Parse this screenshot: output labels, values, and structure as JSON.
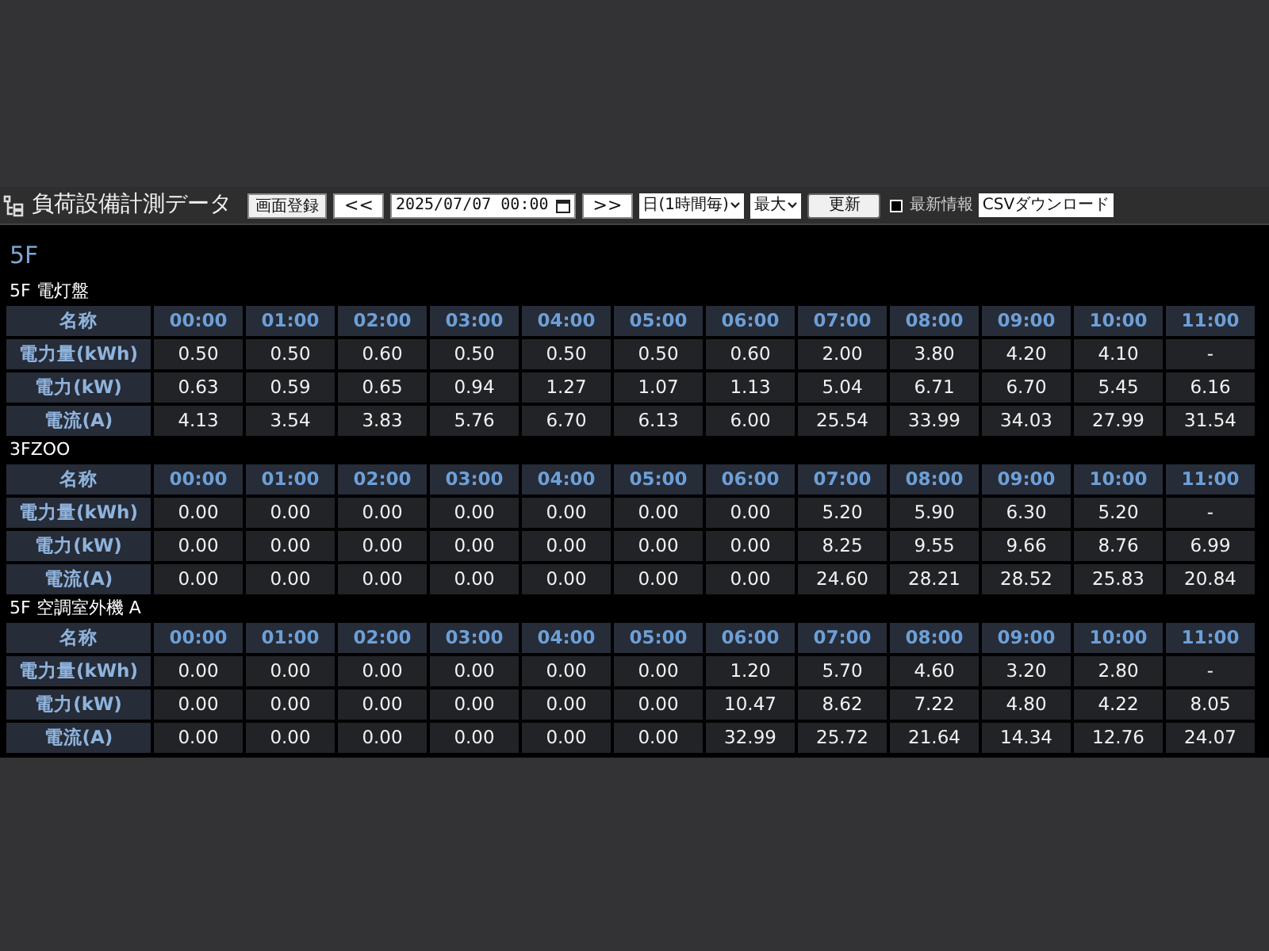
{
  "app": {
    "title": "負荷設備計測データ"
  },
  "toolbar": {
    "register_button": "画面登録",
    "prev_button": "<<",
    "date": "2025/07/07 00:00",
    "next_button": ">>",
    "period_select": "日(1時間毎)",
    "mode_select": "最大",
    "update_button": "更新",
    "latest_info": {
      "label": "最新情報",
      "checked": false
    },
    "csv_button": "CSVダウンロード"
  },
  "floor": "5F",
  "sections": [
    {
      "title": "5F 電灯盤",
      "header": "名称",
      "times": [
        "00:00",
        "01:00",
        "02:00",
        "03:00",
        "04:00",
        "05:00",
        "06:00",
        "07:00",
        "08:00",
        "09:00",
        "10:00",
        "11:00"
      ],
      "rows": [
        {
          "label": "電力量(kWh)",
          "values": [
            "0.50",
            "0.50",
            "0.60",
            "0.50",
            "0.50",
            "0.50",
            "0.60",
            "2.00",
            "3.80",
            "4.20",
            "4.10",
            "-"
          ]
        },
        {
          "label": "電力(kW)",
          "values": [
            "0.63",
            "0.59",
            "0.65",
            "0.94",
            "1.27",
            "1.07",
            "1.13",
            "5.04",
            "6.71",
            "6.70",
            "5.45",
            "6.16"
          ]
        },
        {
          "label": "電流(A)",
          "values": [
            "4.13",
            "3.54",
            "3.83",
            "5.76",
            "6.70",
            "6.13",
            "6.00",
            "25.54",
            "33.99",
            "34.03",
            "27.99",
            "31.54"
          ]
        }
      ]
    },
    {
      "title": "3FZOO",
      "header": "名称",
      "times": [
        "00:00",
        "01:00",
        "02:00",
        "03:00",
        "04:00",
        "05:00",
        "06:00",
        "07:00",
        "08:00",
        "09:00",
        "10:00",
        "11:00"
      ],
      "rows": [
        {
          "label": "電力量(kWh)",
          "values": [
            "0.00",
            "0.00",
            "0.00",
            "0.00",
            "0.00",
            "0.00",
            "0.00",
            "5.20",
            "5.90",
            "6.30",
            "5.20",
            "-"
          ]
        },
        {
          "label": "電力(kW)",
          "values": [
            "0.00",
            "0.00",
            "0.00",
            "0.00",
            "0.00",
            "0.00",
            "0.00",
            "8.25",
            "9.55",
            "9.66",
            "8.76",
            "6.99"
          ]
        },
        {
          "label": "電流(A)",
          "values": [
            "0.00",
            "0.00",
            "0.00",
            "0.00",
            "0.00",
            "0.00",
            "0.00",
            "24.60",
            "28.21",
            "28.52",
            "25.83",
            "20.84"
          ]
        }
      ]
    },
    {
      "title": "5F 空調室外機 A",
      "header": "名称",
      "times": [
        "00:00",
        "01:00",
        "02:00",
        "03:00",
        "04:00",
        "05:00",
        "06:00",
        "07:00",
        "08:00",
        "09:00",
        "10:00",
        "11:00"
      ],
      "rows": [
        {
          "label": "電力量(kWh)",
          "values": [
            "0.00",
            "0.00",
            "0.00",
            "0.00",
            "0.00",
            "0.00",
            "1.20",
            "5.70",
            "4.60",
            "3.20",
            "2.80",
            "-"
          ]
        },
        {
          "label": "電力(kW)",
          "values": [
            "0.00",
            "0.00",
            "0.00",
            "0.00",
            "0.00",
            "0.00",
            "10.47",
            "8.62",
            "7.22",
            "4.80",
            "4.22",
            "8.05"
          ]
        },
        {
          "label": "電流(A)",
          "values": [
            "0.00",
            "0.00",
            "0.00",
            "0.00",
            "0.00",
            "0.00",
            "32.99",
            "25.72",
            "21.64",
            "14.34",
            "12.76",
            "24.07"
          ]
        }
      ]
    }
  ]
}
